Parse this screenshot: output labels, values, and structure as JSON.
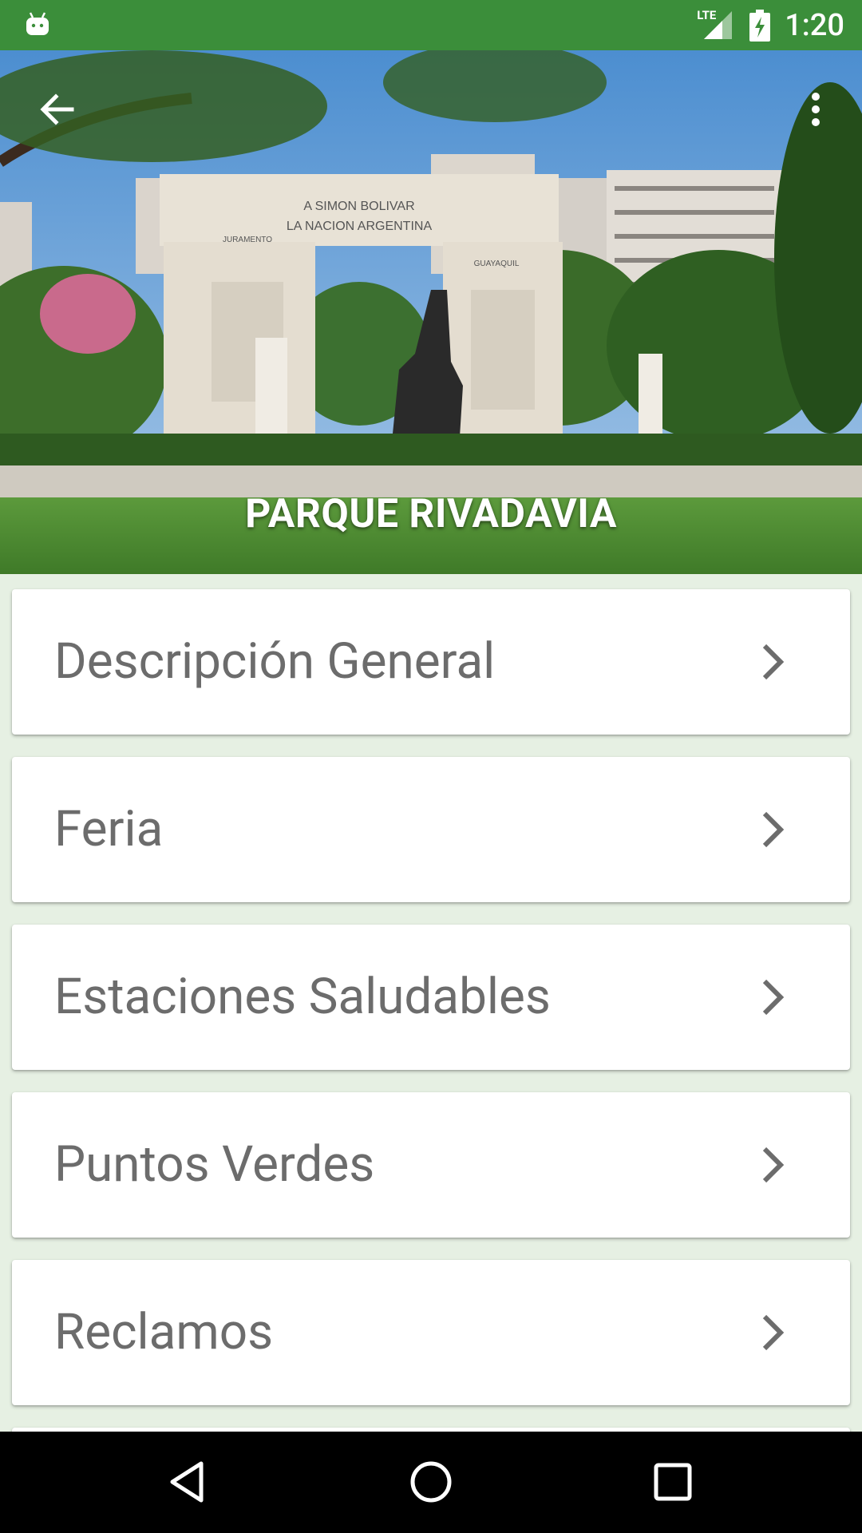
{
  "status_bar": {
    "network": "LTE",
    "time": "1:20"
  },
  "header": {
    "title": "PARQUE RIVADAVIA",
    "photo_signs": {
      "monument_inscription_1": "A SIMON BOLIVAR",
      "monument_inscription_2": "LA NACION ARGENTINA",
      "left_panel": "JURAMENTO",
      "right_panel": "GUAYAQUIL"
    }
  },
  "menu": {
    "items": [
      {
        "label": "Descripción General"
      },
      {
        "label": "Feria"
      },
      {
        "label": "Estaciones Saludables"
      },
      {
        "label": "Puntos Verdes"
      },
      {
        "label": "Reclamos"
      }
    ]
  },
  "colors": {
    "status_bar": "#3b8e3a",
    "page_background": "#e6f0e3",
    "card_text": "#6c6c6c"
  }
}
